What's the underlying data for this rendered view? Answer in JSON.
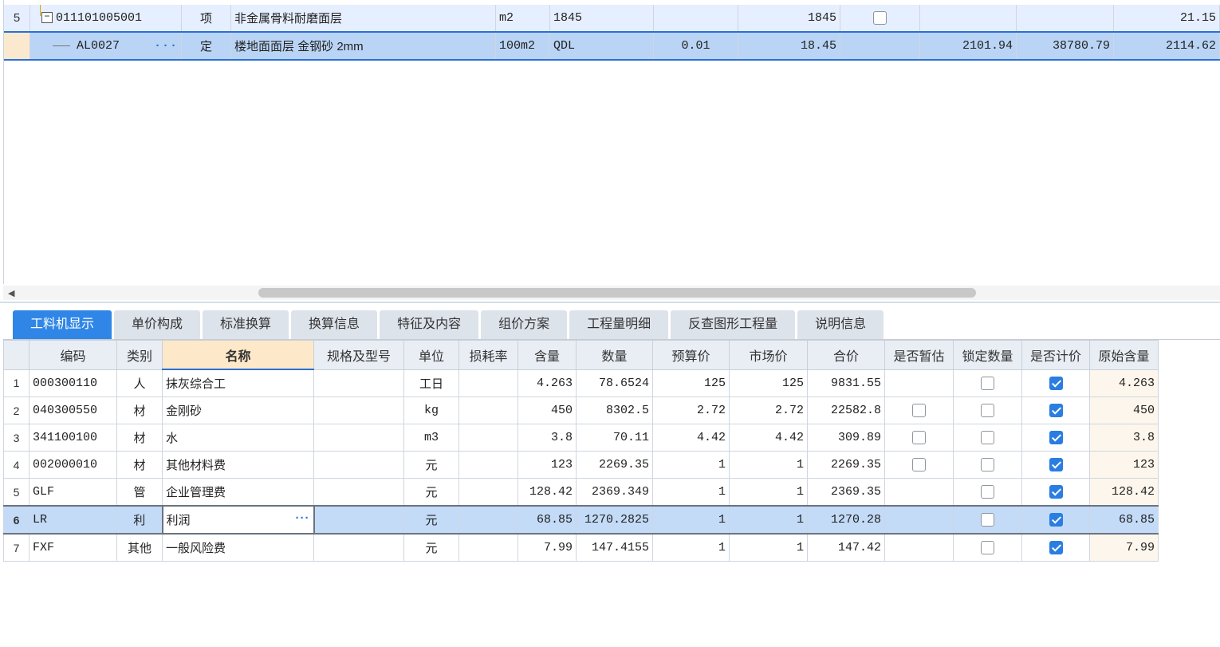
{
  "top": {
    "rows": [
      {
        "num": "5",
        "code": "011101005001",
        "type": "项",
        "name": "非金属骨料耐磨面层",
        "unit": "m2",
        "expr": "1845",
        "coef": "",
        "qty": "1845",
        "check": false,
        "c9": "",
        "c10": "",
        "c11": "21.15"
      },
      {
        "num": "",
        "code": "AL0027",
        "type": "定",
        "name": "楼地面面层 金钢砂 2mm",
        "unit": "100m2",
        "expr": "QDL",
        "coef": "0.01",
        "qty": "18.45",
        "check": null,
        "c9": "2101.94",
        "c10": "38780.79",
        "c11": "2114.62"
      }
    ],
    "dots": "···"
  },
  "tabs": [
    "工料机显示",
    "单价构成",
    "标准换算",
    "换算信息",
    "特征及内容",
    "组价方案",
    "工程量明细",
    "反查图形工程量",
    "说明信息"
  ],
  "active_tab": 0,
  "grid": {
    "headers": [
      "",
      "编码",
      "类别",
      "名称",
      "规格及型号",
      "单位",
      "损耗率",
      "含量",
      "数量",
      "预算价",
      "市场价",
      "合价",
      "是否暂估",
      "锁定数量",
      "是否计价",
      "原始含量"
    ],
    "rows": [
      {
        "num": "1",
        "code": "000300110",
        "cat": "人",
        "name": "抹灰综合工",
        "spec": "",
        "unit": "工日",
        "loss": "",
        "content": "4.263",
        "qty": "78.6524",
        "budget": "125",
        "market": "125",
        "total": "9831.55",
        "temp": null,
        "lock": false,
        "priced": true,
        "orig": "4.263"
      },
      {
        "num": "2",
        "code": "040300550",
        "cat": "材",
        "name": "金刚砂",
        "spec": "",
        "unit": "kg",
        "loss": "",
        "content": "450",
        "qty": "8302.5",
        "budget": "2.72",
        "market": "2.72",
        "total": "22582.8",
        "temp": false,
        "lock": false,
        "priced": true,
        "orig": "450"
      },
      {
        "num": "3",
        "code": "341100100",
        "cat": "材",
        "name": "水",
        "spec": "",
        "unit": "m3",
        "loss": "",
        "content": "3.8",
        "qty": "70.11",
        "budget": "4.42",
        "market": "4.42",
        "total": "309.89",
        "temp": false,
        "lock": false,
        "priced": true,
        "orig": "3.8"
      },
      {
        "num": "4",
        "code": "002000010",
        "cat": "材",
        "name": "其他材料费",
        "spec": "",
        "unit": "元",
        "loss": "",
        "content": "123",
        "qty": "2269.35",
        "budget": "1",
        "market": "1",
        "total": "2269.35",
        "temp": false,
        "lock": false,
        "priced": true,
        "orig": "123"
      },
      {
        "num": "5",
        "code": "GLF",
        "cat": "管",
        "name": "企业管理费",
        "spec": "",
        "unit": "元",
        "loss": "",
        "content": "128.42",
        "qty": "2369.349",
        "budget": "1",
        "market": "1",
        "total": "2369.35",
        "temp": null,
        "lock": false,
        "priced": true,
        "orig": "128.42"
      },
      {
        "num": "6",
        "code": "LR",
        "cat": "利",
        "name": "利润",
        "spec": "",
        "unit": "元",
        "loss": "",
        "content": "68.85",
        "qty": "1270.2825",
        "budget": "1",
        "market": "1",
        "total": "1270.28",
        "temp": null,
        "lock": false,
        "priced": true,
        "orig": "68.85"
      },
      {
        "num": "7",
        "code": "FXF",
        "cat": "其他",
        "name": "一般风险费",
        "spec": "",
        "unit": "元",
        "loss": "",
        "content": "7.99",
        "qty": "147.4155",
        "budget": "1",
        "market": "1",
        "total": "147.42",
        "temp": null,
        "lock": false,
        "priced": true,
        "orig": "7.99"
      }
    ],
    "selected_row": 5
  }
}
